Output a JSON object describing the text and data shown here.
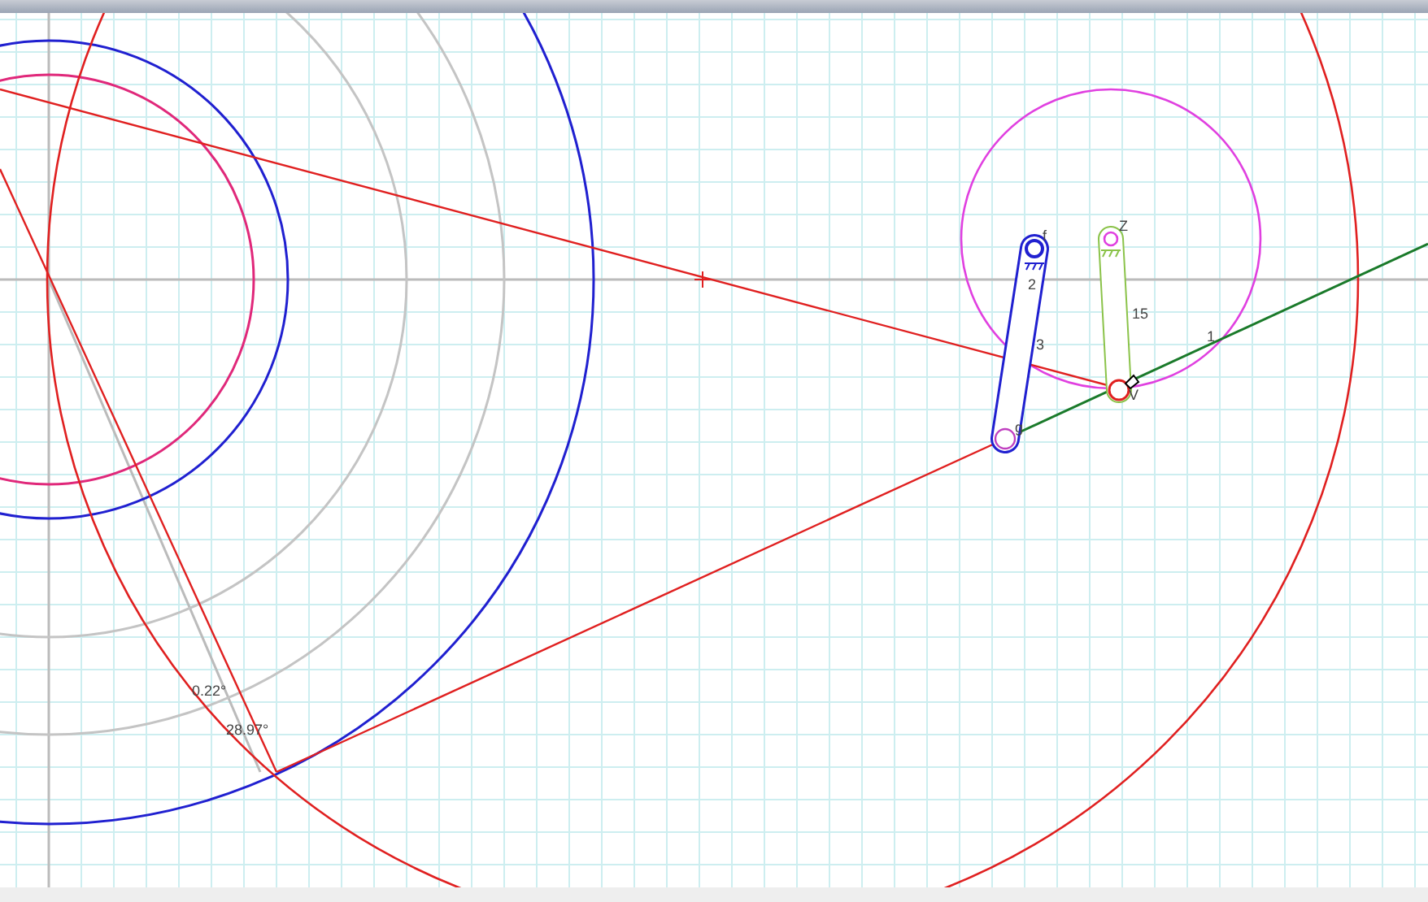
{
  "point_labels": [
    "f",
    "Z",
    "2",
    "3",
    "15",
    "1",
    "V",
    "g"
  ],
  "angle_labels": [
    "0.22°",
    "28.97°"
  ]
}
